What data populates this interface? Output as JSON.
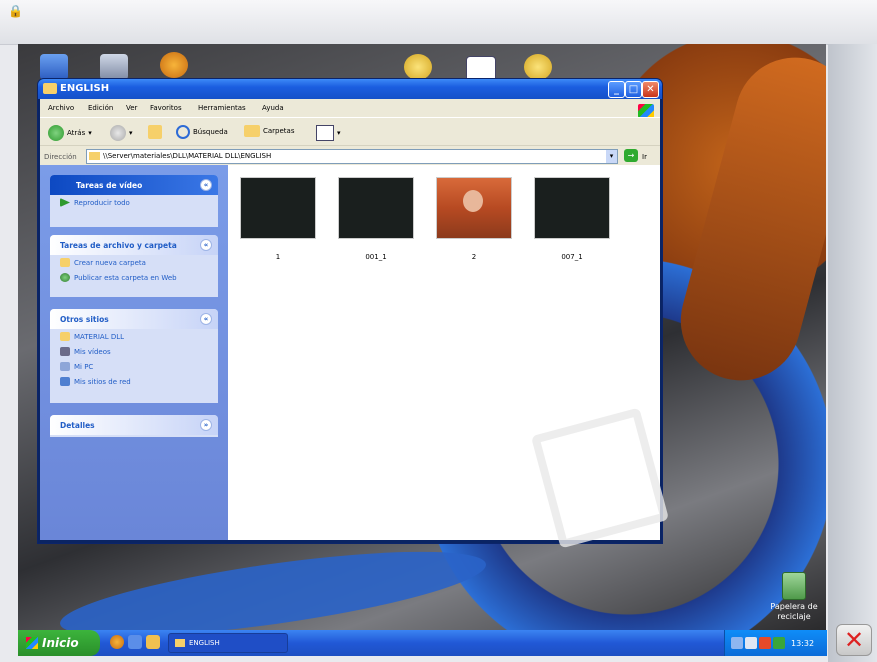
{
  "window": {
    "title": "ENGLISH",
    "menu": [
      "Archivo",
      "Edición",
      "Ver",
      "Favoritos",
      "Herramientas",
      "Ayuda"
    ],
    "toolbar": {
      "back_label": "Atrás",
      "search_label": "Búsqueda",
      "folders_label": "Carpetas"
    },
    "address": {
      "label": "Dirección",
      "value": "\\\\Server\\materiales\\DLL\\MATERIAL DLL\\ENGLISH",
      "go_label": "Ir"
    }
  },
  "sidebar": {
    "video_tasks": {
      "title": "Tareas de vídeo",
      "items": [
        "Reproducir todo"
      ]
    },
    "file_tasks": {
      "title": "Tareas de archivo y carpeta",
      "items": [
        "Crear nueva carpeta",
        "Publicar esta carpeta en Web"
      ]
    },
    "other_places": {
      "title": "Otros sitios",
      "items": [
        "MATERIAL DLL",
        "Mis vídeos",
        "Mi PC",
        "Mis sitios de red"
      ]
    },
    "details": {
      "title": "Detalles"
    }
  },
  "files": [
    {
      "name": "1"
    },
    {
      "name": "001_1"
    },
    {
      "name": "2"
    },
    {
      "name": "007_1"
    }
  ],
  "desktop": {
    "recycle_bin_label": "Papelera de reciclaje"
  },
  "taskbar": {
    "start_label": "Inicio",
    "task_label": "ENGLISH",
    "clock": "13:32"
  },
  "colors": {
    "title_bar": "#1b5ee0",
    "sidebar_bg": "#7b9ce8",
    "start_button": "#2a8f2a",
    "taskbar": "#2158d6"
  }
}
